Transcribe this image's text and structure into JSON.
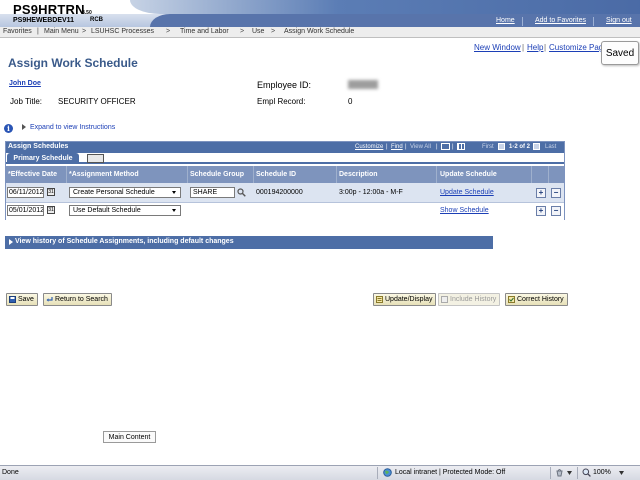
{
  "header": {
    "system_name": "PS9HRTRN",
    "system_version": "8.50",
    "web_server": "PS9HEWEBDEV11",
    "user_code": "RCB",
    "links": [
      "Home",
      "Add to Favorites",
      "Sign out"
    ]
  },
  "breadcrumb": [
    "Favorites",
    "Main Menu",
    "LSUHSC Processes",
    "Time and Labor",
    "Use",
    "Assign Work Schedule"
  ],
  "page_links": {
    "new_window": "New Window",
    "help": "Help",
    "customize": "Customize Pag"
  },
  "saved_popup": "Saved",
  "page_title": "Assign Work Schedule",
  "employee": {
    "name": "John Doe",
    "job_title_label": "Job Title:",
    "job_title": "SECURITY OFFICER",
    "emp_id_label": "Employee ID:",
    "empl_record_label": "Empl Record:",
    "empl_record": "0"
  },
  "instructions_link": "Expand to view Instructions",
  "grid": {
    "title": "Assign Schedules",
    "nav": {
      "customize": "Customize",
      "find": "Find",
      "view_all": "View All",
      "first": "First",
      "range": "1-2 of 2",
      "last": "Last"
    },
    "tab": "Primary Schedule",
    "columns": [
      "*Effective Date",
      "*Assignment Method",
      "Schedule Group",
      "Schedule ID",
      "Description",
      "Update Schedule"
    ],
    "rows": [
      {
        "effective_date": "06/11/2012",
        "method": "Create Personal Schedule",
        "group": "SHARE",
        "schedule_id": "000194200000",
        "description": "3:00p - 12:00a - M-F",
        "link": "Update Schedule"
      },
      {
        "effective_date": "05/01/2012",
        "method": "Use Default Schedule",
        "group": "",
        "schedule_id": "",
        "description": "",
        "link": "Show Schedule"
      }
    ]
  },
  "history_bar": "View history of Schedule Assignments, including default changes",
  "buttons": {
    "save": "Save",
    "return": "Return to Search",
    "update_display": "Update/Display",
    "include_history": "Include History",
    "correct_history": "Correct History"
  },
  "main_content": "Main Content",
  "status": {
    "left": "Done",
    "zone": "Local intranet | Protected Mode: Off",
    "zoom": "100%"
  },
  "colors": {
    "accent": "#4d6ea6",
    "link": "#1c3fb6",
    "title": "#3a5a8a"
  }
}
